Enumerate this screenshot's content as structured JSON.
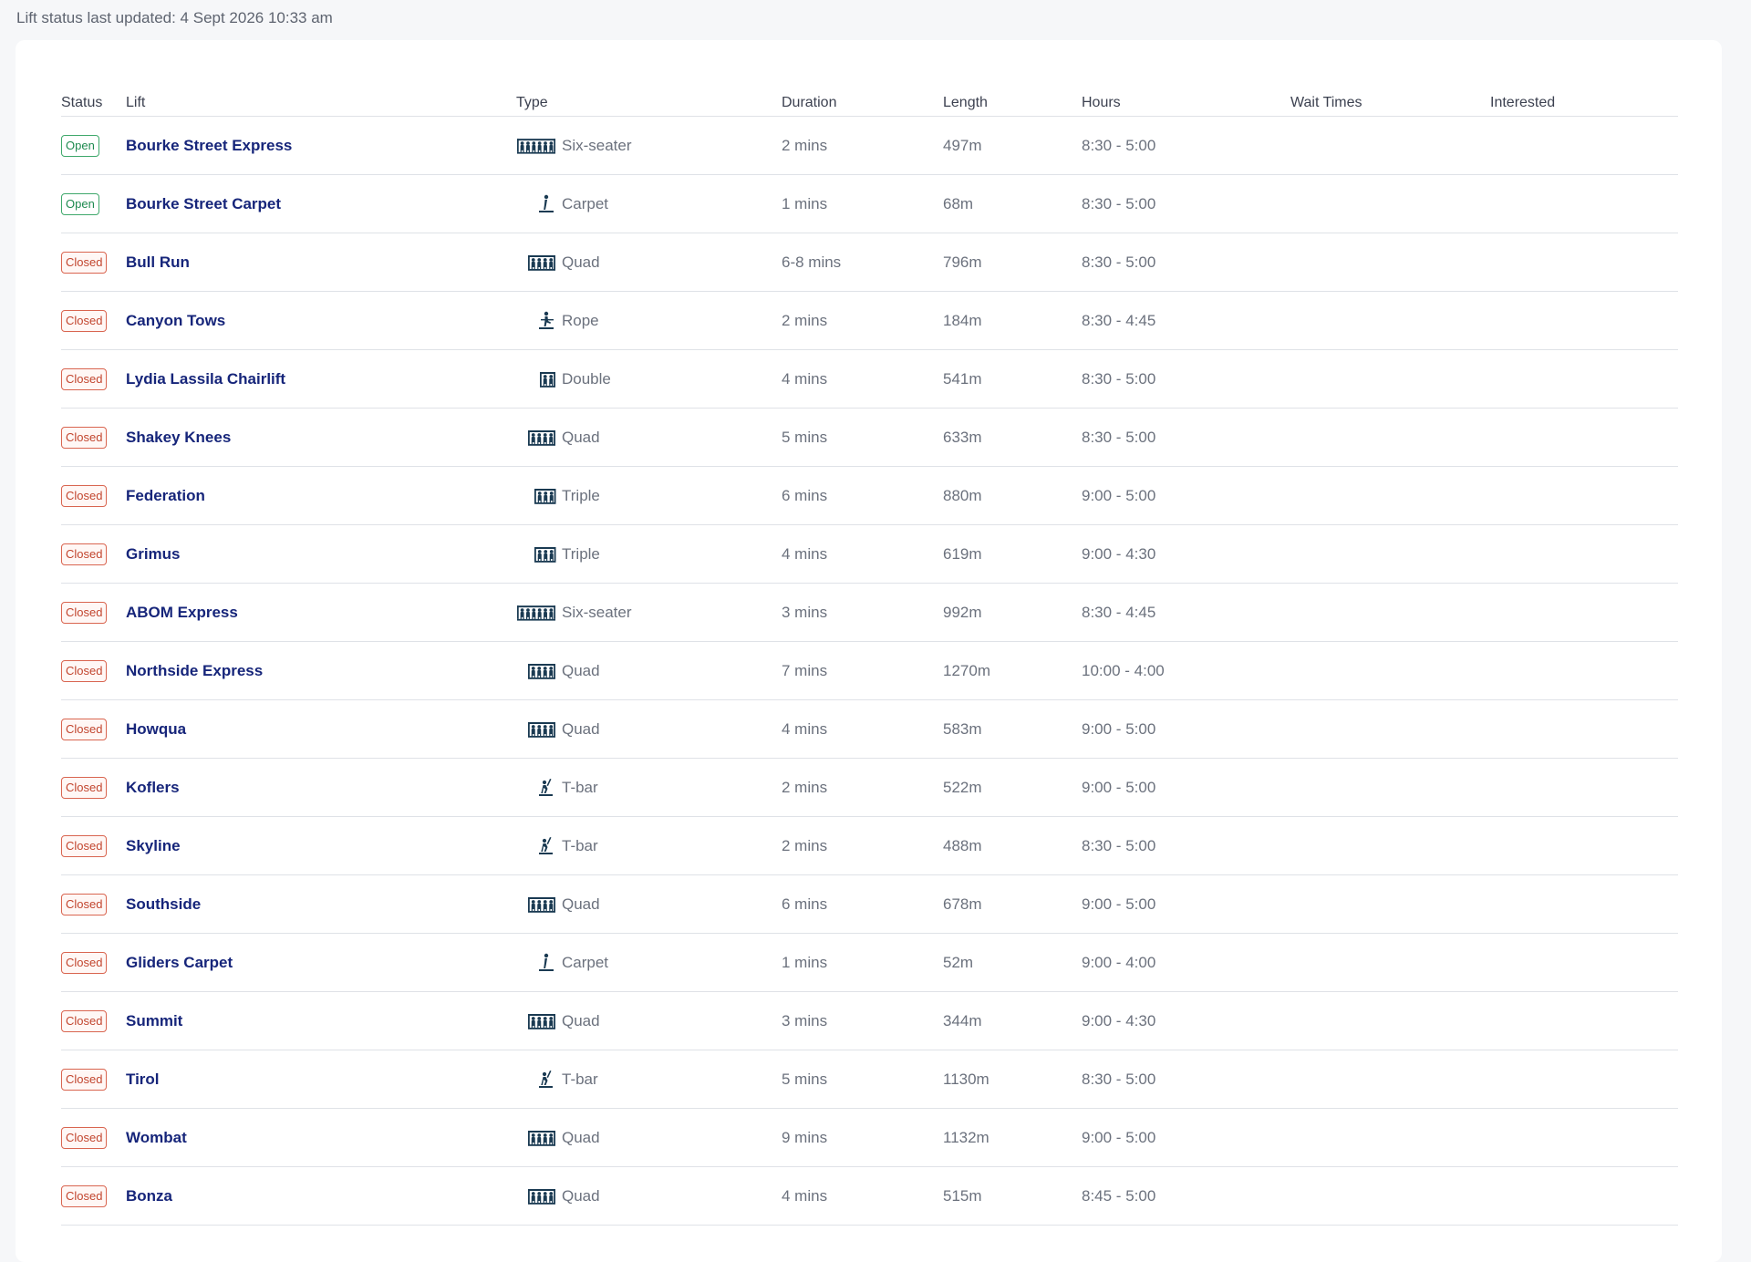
{
  "status_updated": "Lift status last updated: 4 Sept 2026 10:33 am",
  "columns": [
    "Status",
    "Lift",
    "Type",
    "Duration",
    "Length",
    "Hours",
    "Wait Times",
    "Interested"
  ],
  "colors": {
    "open": "#1e8a4f",
    "closed": "#c2452e",
    "lift_name": "#16257a",
    "icon": "#1a3a52"
  },
  "lifts": [
    {
      "status": "Open",
      "name": "Bourke Street Express",
      "type": "Six-seater",
      "icon": "six-seater-chair-icon",
      "duration": "2 mins",
      "length": "497m",
      "hours": "8:30 - 5:00"
    },
    {
      "status": "Open",
      "name": "Bourke Street Carpet",
      "type": "Carpet",
      "icon": "carpet-lift-icon",
      "duration": "1 mins",
      "length": "68m",
      "hours": "8:30 - 5:00"
    },
    {
      "status": "Closed",
      "name": "Bull Run",
      "type": "Quad",
      "icon": "quad-chair-icon",
      "duration": "6-8 mins",
      "length": "796m",
      "hours": "8:30 - 5:00"
    },
    {
      "status": "Closed",
      "name": "Canyon Tows",
      "type": "Rope",
      "icon": "rope-tow-icon",
      "duration": "2 mins",
      "length": "184m",
      "hours": "8:30 - 4:45"
    },
    {
      "status": "Closed",
      "name": "Lydia Lassila Chairlift",
      "type": "Double",
      "icon": "double-chair-icon",
      "duration": "4 mins",
      "length": "541m",
      "hours": "8:30 - 5:00"
    },
    {
      "status": "Closed",
      "name": "Shakey Knees",
      "type": "Quad",
      "icon": "quad-chair-icon",
      "duration": "5 mins",
      "length": "633m",
      "hours": "8:30 - 5:00"
    },
    {
      "status": "Closed",
      "name": "Federation",
      "type": "Triple",
      "icon": "triple-chair-icon",
      "duration": "6 mins",
      "length": "880m",
      "hours": "9:00 - 5:00"
    },
    {
      "status": "Closed",
      "name": "Grimus",
      "type": "Triple",
      "icon": "triple-chair-icon",
      "duration": "4 mins",
      "length": "619m",
      "hours": "9:00 - 4:30"
    },
    {
      "status": "Closed",
      "name": "ABOM Express",
      "type": "Six-seater",
      "icon": "six-seater-chair-icon",
      "duration": "3 mins",
      "length": "992m",
      "hours": "8:30 - 4:45"
    },
    {
      "status": "Closed",
      "name": "Northside Express",
      "type": "Quad",
      "icon": "quad-chair-icon",
      "duration": "7 mins",
      "length": "1270m",
      "hours": "10:00 - 4:00"
    },
    {
      "status": "Closed",
      "name": "Howqua",
      "type": "Quad",
      "icon": "quad-chair-icon",
      "duration": "4 mins",
      "length": "583m",
      "hours": "9:00 - 5:00"
    },
    {
      "status": "Closed",
      "name": "Koflers",
      "type": "T-bar",
      "icon": "t-bar-icon",
      "duration": "2 mins",
      "length": "522m",
      "hours": "9:00 - 5:00"
    },
    {
      "status": "Closed",
      "name": "Skyline",
      "type": "T-bar",
      "icon": "t-bar-icon",
      "duration": "2 mins",
      "length": "488m",
      "hours": "8:30 - 5:00"
    },
    {
      "status": "Closed",
      "name": "Southside",
      "type": "Quad",
      "icon": "quad-chair-icon",
      "duration": "6 mins",
      "length": "678m",
      "hours": "9:00 - 5:00"
    },
    {
      "status": "Closed",
      "name": "Gliders Carpet",
      "type": "Carpet",
      "icon": "carpet-lift-icon",
      "duration": "1 mins",
      "length": "52m",
      "hours": "9:00 - 4:00"
    },
    {
      "status": "Closed",
      "name": "Summit",
      "type": "Quad",
      "icon": "quad-chair-icon",
      "duration": "3 mins",
      "length": "344m",
      "hours": "9:00 - 4:30"
    },
    {
      "status": "Closed",
      "name": "Tirol",
      "type": "T-bar",
      "icon": "t-bar-icon",
      "duration": "5 mins",
      "length": "1130m",
      "hours": "8:30 - 5:00"
    },
    {
      "status": "Closed",
      "name": "Wombat",
      "type": "Quad",
      "icon": "quad-chair-icon",
      "duration": "9 mins",
      "length": "1132m",
      "hours": "9:00 - 5:00"
    },
    {
      "status": "Closed",
      "name": "Bonza",
      "type": "Quad",
      "icon": "quad-chair-icon",
      "duration": "4 mins",
      "length": "515m",
      "hours": "8:45 - 5:00"
    }
  ]
}
